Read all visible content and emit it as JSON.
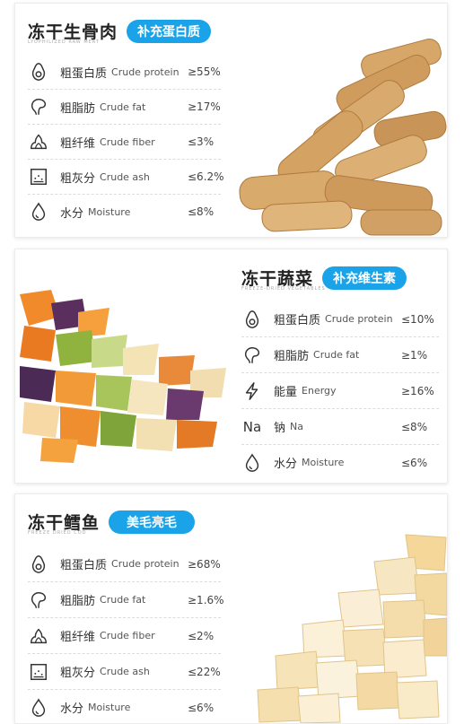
{
  "card1": {
    "title": "冻干生骨肉",
    "badge": "补充蛋白质",
    "subtitle": "LYOPHILIZED RAW MEAT",
    "rows": [
      {
        "icon": "avocado-icon",
        "zh": "粗蛋白质",
        "en": "Crude protein",
        "value": "≥55%"
      },
      {
        "icon": "fat-icon",
        "zh": "粗脂肪",
        "en": "Crude fat",
        "value": "≥17%"
      },
      {
        "icon": "fiber-icon",
        "zh": "粗纤维",
        "en": "Crude fiber",
        "value": "≤3%"
      },
      {
        "icon": "ash-icon",
        "zh": "粗灰分",
        "en": "Crude ash",
        "value": "≤6.2%"
      },
      {
        "icon": "water-drop-icon",
        "zh": "水分",
        "en": "Moisture",
        "value": "≤8%"
      }
    ]
  },
  "card2": {
    "title": "冻干蔬菜",
    "badge": "补充维生素",
    "subtitle": "FREEZE-DRIED VEGETABLES",
    "rows": [
      {
        "icon": "avocado-icon",
        "zh": "粗蛋白质",
        "en": "Crude protein",
        "value": "≤10%"
      },
      {
        "icon": "fat-icon",
        "zh": "粗脂肪",
        "en": "Crude fat",
        "value": "≥1%"
      },
      {
        "icon": "lightning-icon",
        "zh": "能量",
        "en": "Energy",
        "value": "≥16%"
      },
      {
        "icon": "sodium-icon",
        "icon_text": "Na",
        "zh": "钠",
        "en": "Na",
        "value": "≤8%"
      },
      {
        "icon": "water-drop-icon",
        "zh": "水分",
        "en": "Moisture",
        "value": "≤6%"
      }
    ]
  },
  "card3": {
    "title": "冻干鳕鱼",
    "badge": "美毛亮毛",
    "subtitle": "FREEZE DRIED COD",
    "rows": [
      {
        "icon": "avocado-icon",
        "zh": "粗蛋白质",
        "en": "Crude protein",
        "value": "≥68%"
      },
      {
        "icon": "fat-icon",
        "zh": "粗脂肪",
        "en": "Crude fat",
        "value": "≥1.6%"
      },
      {
        "icon": "fiber-icon",
        "zh": "粗纤维",
        "en": "Crude fiber",
        "value": "≤2%"
      },
      {
        "icon": "ash-icon",
        "zh": "粗灰分",
        "en": "Crude ash",
        "value": "≤22%"
      },
      {
        "icon": "water-drop-icon",
        "zh": "水分",
        "en": "Moisture",
        "value": "≤6%"
      }
    ]
  },
  "colors": {
    "accent": "#1aa3e8",
    "text": "#333333",
    "divider": "#dcdcdc"
  }
}
